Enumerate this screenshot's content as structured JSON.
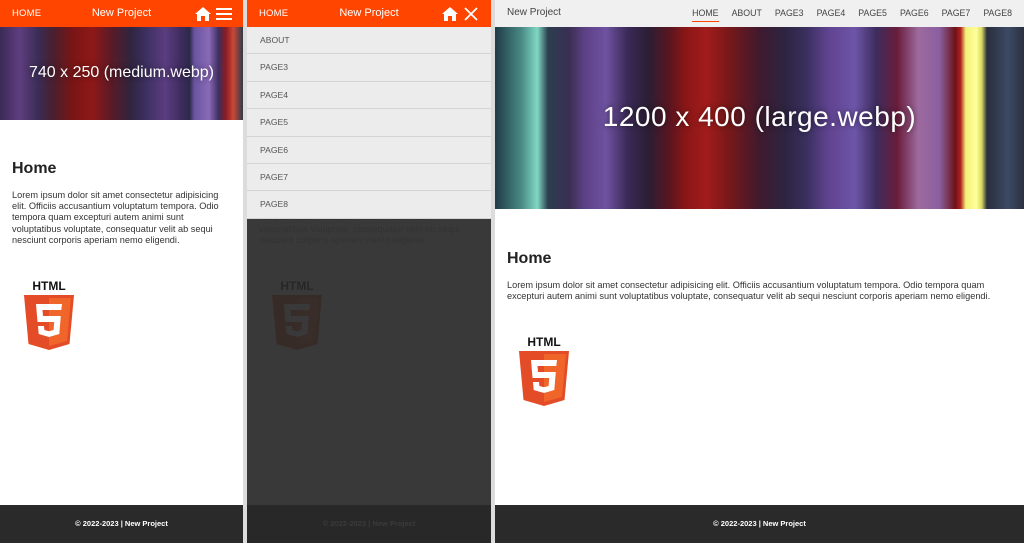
{
  "mobile": {
    "home_label": "HOME",
    "title": "New Project",
    "hero_caption": "740 x 250 (medium.webp)",
    "icons": [
      "home-icon",
      "menu-icon"
    ]
  },
  "menu_open": {
    "home_label": "HOME",
    "title": "New Project",
    "icons": [
      "home-icon",
      "close-icon"
    ],
    "items": [
      "ABOUT",
      "PAGE3",
      "PAGE4",
      "PAGE5",
      "PAGE6",
      "PAGE7",
      "PAGE8"
    ]
  },
  "desktop": {
    "brand": "New Project",
    "nav": [
      "HOME",
      "ABOUT",
      "PAGE3",
      "PAGE4",
      "PAGE5",
      "PAGE6",
      "PAGE7",
      "PAGE8"
    ],
    "active_nav": "HOME",
    "hero_caption": "1200 x 400 (large.webp)"
  },
  "article": {
    "heading": "Home",
    "body": "Lorem ipsum dolor sit amet consectetur adipisicing elit. Officiis accusantium voluptatum tempora. Odio tempora quam excepturi autem animi sunt voluptatibus voluptate, consequatur velit ab sequi nesciunt corporis aperiam nemo eligendi.",
    "logo_text": "HTML"
  },
  "footer": {
    "text": "© 2022-2023 | New Project"
  },
  "colors": {
    "accent": "#ff4500",
    "footer": "#2a2a2a",
    "menu_bg": "#ececec"
  }
}
